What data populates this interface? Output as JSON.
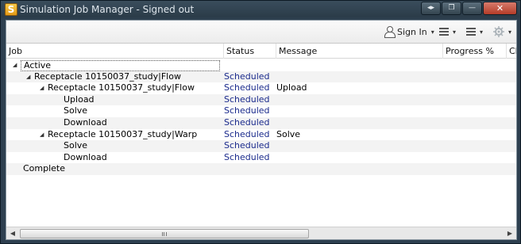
{
  "window": {
    "title": "Simulation Job Manager - Signed out",
    "app_icon_letter": "S",
    "minimize_glyph": "—",
    "restore_glyph": "❐",
    "close_glyph": "✕",
    "extra_glyph": "◂▸"
  },
  "toolbar": {
    "signin_label": "Sign In",
    "caret": "▾"
  },
  "columns": [
    "Job",
    "Status",
    "Message",
    "Progress %",
    "Cl"
  ],
  "tree_glyph": "◢",
  "rows": [
    {
      "job": "Active",
      "status": "",
      "message": ""
    },
    {
      "job": "Receptacle 10150037_study|Flow",
      "status": "Scheduled",
      "message": ""
    },
    {
      "job": "Receptacle 10150037_study|Flow",
      "status": "Scheduled",
      "message": "Upload"
    },
    {
      "job": "Upload",
      "status": "Scheduled",
      "message": ""
    },
    {
      "job": "Solve",
      "status": "Scheduled",
      "message": ""
    },
    {
      "job": "Download",
      "status": "Scheduled",
      "message": ""
    },
    {
      "job": "Receptacle 10150037_study|Warp",
      "status": "Scheduled",
      "message": "Solve"
    },
    {
      "job": "Solve",
      "status": "Scheduled",
      "message": ""
    },
    {
      "job": "Download",
      "status": "Scheduled",
      "message": ""
    },
    {
      "job": "Complete",
      "status": "",
      "message": ""
    }
  ],
  "scrollbar": {
    "left_arrow": "◀",
    "right_arrow": "▶"
  },
  "colors": {
    "status_text": "#1a2a8c",
    "close_button": "#c4483a"
  }
}
